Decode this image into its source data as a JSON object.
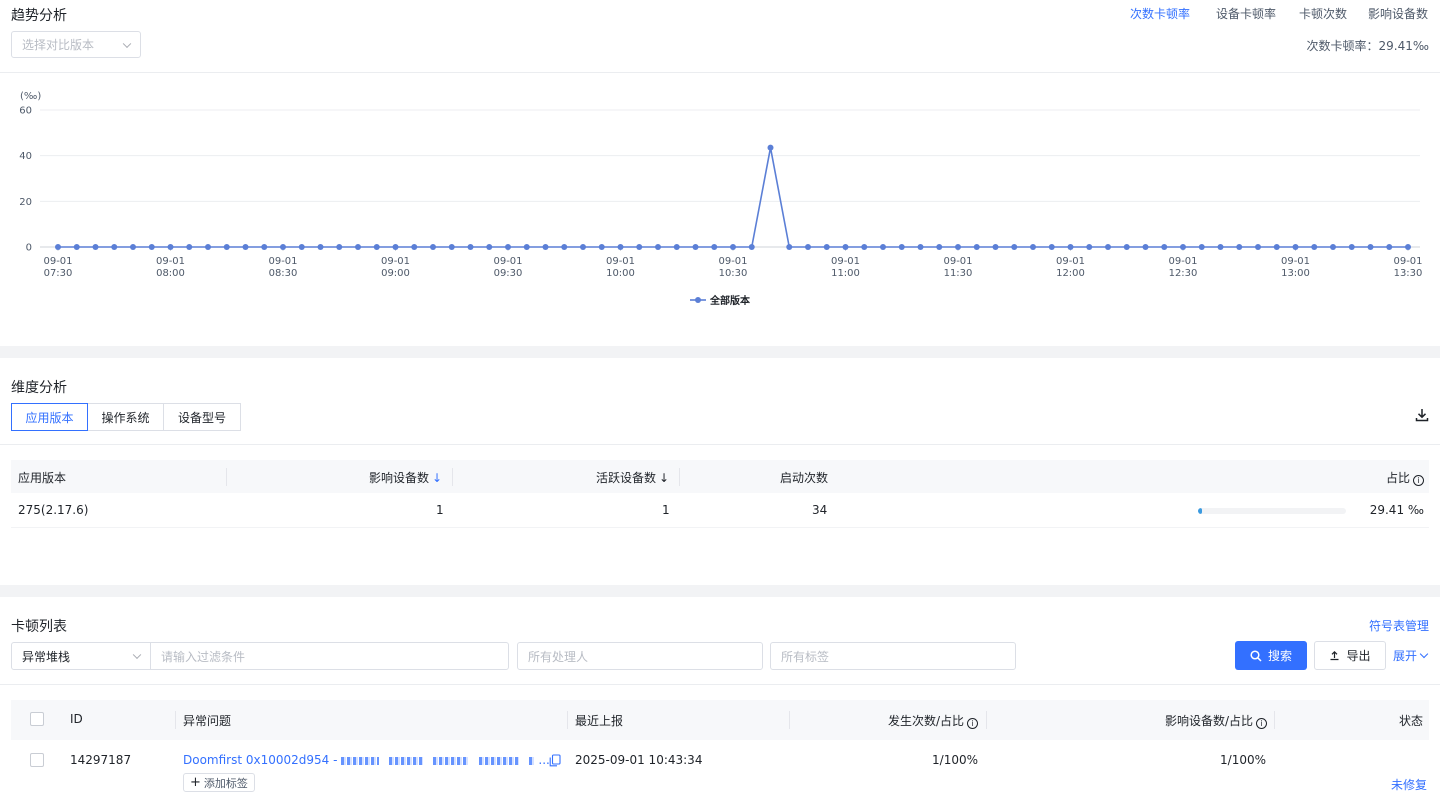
{
  "trend": {
    "title": "趋势分析",
    "compare_placeholder": "选择对比版本",
    "tabs": [
      "次数卡顿率",
      "设备卡顿率",
      "卡顿次数",
      "影响设备数"
    ],
    "summary": "次数卡顿率：29.41‰"
  },
  "chart_data": {
    "type": "line",
    "ylabel": "(‰)",
    "ylim": [
      0,
      60
    ],
    "yticks": [
      0,
      20,
      40,
      60
    ],
    "x_tick_labels": [
      [
        "09-01",
        "07:30"
      ],
      [
        "09-01",
        "08:00"
      ],
      [
        "09-01",
        "08:30"
      ],
      [
        "09-01",
        "09:00"
      ],
      [
        "09-01",
        "09:30"
      ],
      [
        "09-01",
        "10:00"
      ],
      [
        "09-01",
        "10:30"
      ],
      [
        "09-01",
        "11:00"
      ],
      [
        "09-01",
        "11:30"
      ],
      [
        "09-01",
        "12:00"
      ],
      [
        "09-01",
        "12:30"
      ],
      [
        "09-01",
        "13:00"
      ],
      [
        "09-01",
        "13:30"
      ]
    ],
    "grid": true,
    "legend_position": "bottom",
    "series": [
      {
        "name": "全部版本",
        "color": "#5b7fd6",
        "values": [
          0,
          0,
          0,
          0,
          0,
          0,
          0,
          0,
          0,
          0,
          0,
          0,
          0,
          0,
          0,
          0,
          0,
          0,
          0,
          0,
          0,
          0,
          0,
          0,
          0,
          0,
          0,
          0,
          0,
          0,
          0,
          0,
          0,
          0,
          0,
          0,
          0,
          0,
          43.5,
          0,
          0,
          0,
          0,
          0,
          0,
          0,
          0,
          0,
          0,
          0,
          0,
          0,
          0,
          0,
          0,
          0,
          0,
          0,
          0,
          0,
          0,
          0,
          0,
          0,
          0,
          0,
          0,
          0,
          0,
          0,
          0,
          0,
          0
        ]
      }
    ]
  },
  "dimension": {
    "title": "维度分析",
    "tabs": [
      "应用版本",
      "操作系统",
      "设备型号"
    ],
    "columns": [
      "应用版本",
      "影响设备数",
      "活跃设备数",
      "启动次数",
      "占比"
    ],
    "rows": [
      {
        "version": "275(2.17.6)",
        "affected": "1",
        "active": "1",
        "launches": "34",
        "ratio_text": "29.41 ‰",
        "ratio_fraction": 0.029
      }
    ]
  },
  "stutter": {
    "title": "卡顿列表",
    "symbol_link": "符号表管理",
    "filter_type": "异常堆栈",
    "filter_placeholder": "请输入过滤条件",
    "assignee_placeholder": "所有处理人",
    "tag_placeholder": "所有标签",
    "search_label": "搜索",
    "export_label": "导出",
    "expand_label": "展开",
    "columns": [
      "ID",
      "异常问题",
      "最近上报",
      "发生次数/占比",
      "影响设备数/占比",
      "状态"
    ],
    "rows": [
      {
        "id": "14297187",
        "issue": "Doomfirst 0x10002d954 -",
        "issue_tail": "...",
        "add_tag": "添加标签",
        "last_report": "2025-09-01 10:43:34",
        "occurrences": "1/100%",
        "devices": "1/100%",
        "status": "未修复"
      }
    ]
  },
  "colors": {
    "accent": "#3370ff",
    "line": "#5b7fd6",
    "band": "#f2f3f5"
  }
}
